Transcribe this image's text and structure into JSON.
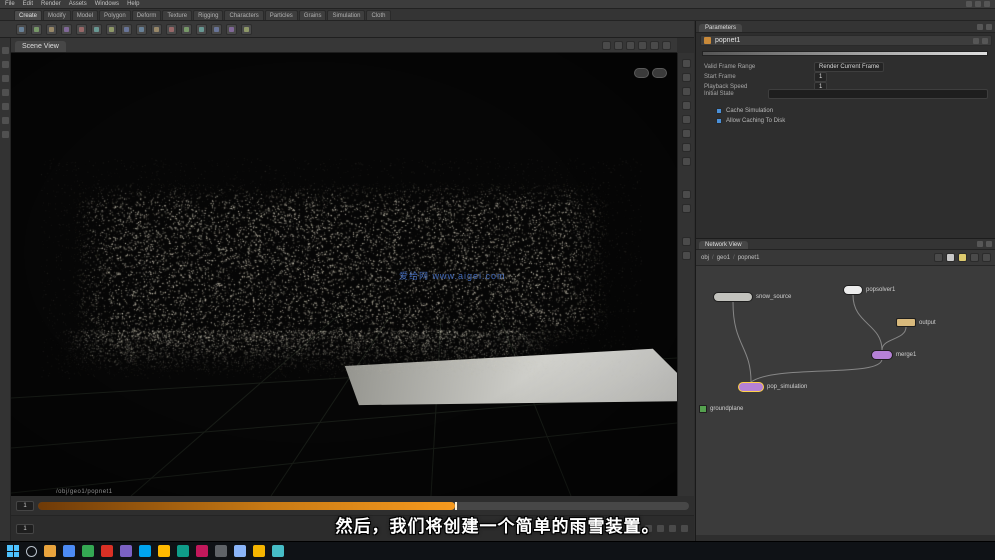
{
  "menubar": {
    "items": [
      "File",
      "Edit",
      "Render",
      "Assets",
      "Windows",
      "Help"
    ]
  },
  "shelf": {
    "tabs": [
      "Create",
      "Modify",
      "Model",
      "Polygon",
      "Deform",
      "Texture",
      "Rigging",
      "Characters",
      "Particles",
      "Grains",
      "Simulation",
      "Cloth"
    ]
  },
  "scene_view": {
    "pane_tab": "Scene View",
    "watermark": "爱给网 www.aigei.com",
    "status_path": "/obj/geo1/popnet1"
  },
  "playbar": {
    "frame": "1"
  },
  "parameters": {
    "pane_tab": "Parameters",
    "node_name": "popnet1",
    "rows": [
      {
        "label": "Valid Frame Range",
        "value": "Render Current Frame"
      },
      {
        "label": "Start Frame",
        "value": "1"
      },
      {
        "label": "Playback Speed",
        "value": "1"
      }
    ],
    "field_label": "Initial State",
    "checks": [
      "Cache Simulation",
      "Allow Caching To Disk"
    ]
  },
  "network": {
    "pane_tab": "Network View",
    "breadcrumb": [
      "obj",
      "geo1",
      "popnet1"
    ],
    "nodes": [
      {
        "label": "snow_source"
      },
      {
        "label": "popsolver1"
      },
      {
        "label": "output"
      },
      {
        "label": "merge1"
      },
      {
        "label": "pop_simulation"
      },
      {
        "label": "groundplane"
      }
    ]
  },
  "subtitle": "然后，我们将创建一个简单的雨雪装置。",
  "colors": {
    "accent_orange": "#f79a1e",
    "node_purple": "#b581d6",
    "node_green": "#55a14f",
    "watermark_blue": "#5587eb"
  }
}
